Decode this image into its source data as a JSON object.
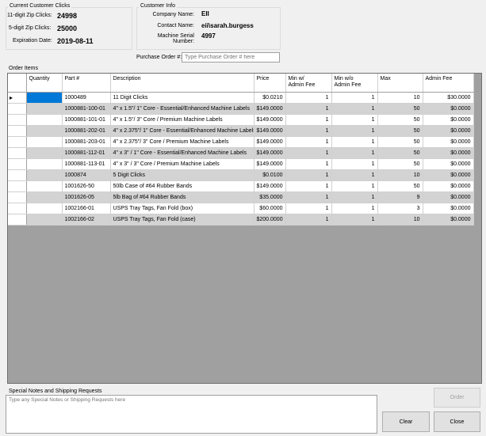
{
  "clicks": {
    "title": "Current Customer Clicks",
    "digit11_label": "11-digit Zip Clicks:",
    "digit11_value": "24998",
    "digit5_label": "5-digit Zip Clicks:",
    "digit5_value": "25000",
    "expiration_label": "Expiration Date:",
    "expiration_value": "2019-08-11"
  },
  "customer": {
    "title": "Customer Info",
    "company_label": "Company Name:",
    "company_value": "EII",
    "contact_label": "Contact Name:",
    "contact_value": "eii\\sarah.burgess",
    "serial_label": "Machine Serial Number:",
    "serial_value": "4997"
  },
  "po": {
    "label": "Purchase Order #:",
    "placeholder": "Type Purchase Order # here"
  },
  "order_items": {
    "title": "Order Items",
    "columns": {
      "quantity": "Quantity",
      "part": "Part #",
      "description": "Description",
      "price": "Price",
      "min_w_1": "Min w/",
      "min_w_2": "Admin Fee",
      "min_wo_1": "Min w/o",
      "min_wo_2": "Admin Fee",
      "max": "Max",
      "admin_fee": "Admin Fee"
    },
    "rows": [
      {
        "quantity": "",
        "part": "1000489",
        "description": "11 Digit Clicks",
        "price": "$0.0210",
        "min_w": "1",
        "min_wo": "1",
        "max": "10",
        "admin_fee": "$30.0000"
      },
      {
        "quantity": "",
        "part": "1000881-100-01",
        "description": "4\" x 1.5\"/ 1\" Core - Essential/Enhanced Machine Labels",
        "price": "$149.0000",
        "min_w": "1",
        "min_wo": "1",
        "max": "50",
        "admin_fee": "$0.0000"
      },
      {
        "quantity": "",
        "part": "1000881-101-01",
        "description": "4\" x 1.5\"/ 3\" Core / Premium Machine Labels",
        "price": "$149.0000",
        "min_w": "1",
        "min_wo": "1",
        "max": "50",
        "admin_fee": "$0.0000"
      },
      {
        "quantity": "",
        "part": "1000881-202-01",
        "description": "4\" x 2.375\"/ 1\" Core - Essential/Enhanced Machine Labels",
        "price": "$149.0000",
        "min_w": "1",
        "min_wo": "1",
        "max": "50",
        "admin_fee": "$0.0000"
      },
      {
        "quantity": "",
        "part": "1000881-203-01",
        "description": "4\" x 2.375\"/ 3\" Core / Premium Machine Labels",
        "price": "$149.0000",
        "min_w": "1",
        "min_wo": "1",
        "max": "50",
        "admin_fee": "$0.0000"
      },
      {
        "quantity": "",
        "part": "1000881-112-01",
        "description": "4\" x 3\" / 1\" Core - Essential/Enhanced Machine Labels",
        "price": "$149.0000",
        "min_w": "1",
        "min_wo": "1",
        "max": "50",
        "admin_fee": "$0.0000"
      },
      {
        "quantity": "",
        "part": "1000881-113-01",
        "description": "4\" x 3\" / 3\" Core / Premium Machine Labels",
        "price": "$149.0000",
        "min_w": "1",
        "min_wo": "1",
        "max": "50",
        "admin_fee": "$0.0000"
      },
      {
        "quantity": "",
        "part": "1000874",
        "description": "5 Digit Clicks",
        "price": "$0.0100",
        "min_w": "1",
        "min_wo": "1",
        "max": "10",
        "admin_fee": "$0.0000"
      },
      {
        "quantity": "",
        "part": "1001626-50",
        "description": "50lb Case of #64 Rubber Bands",
        "price": "$149.0000",
        "min_w": "1",
        "min_wo": "1",
        "max": "50",
        "admin_fee": "$0.0000"
      },
      {
        "quantity": "",
        "part": "1001626-05",
        "description": "5lb Bag of #64 Rubber Bands",
        "price": "$35.0000",
        "min_w": "1",
        "min_wo": "1",
        "max": "9",
        "admin_fee": "$0.0000"
      },
      {
        "quantity": "",
        "part": "1002166-01",
        "description": "USPS Tray Tags, Fan Fold (box)",
        "price": "$60.0000",
        "min_w": "1",
        "min_wo": "1",
        "max": "3",
        "admin_fee": "$0.0000"
      },
      {
        "quantity": "",
        "part": "1002166-02",
        "description": "USPS Tray Tags, Fan Fold (case)",
        "price": "$200.0000",
        "min_w": "1",
        "min_wo": "1",
        "max": "10",
        "admin_fee": "$0.0000"
      }
    ]
  },
  "notes": {
    "title": "Special Notes and Shipping Requests",
    "placeholder": "Type any Special Notes or Shipping Requests here"
  },
  "buttons": {
    "order": "Order",
    "clear": "Clear",
    "close": "Close"
  }
}
